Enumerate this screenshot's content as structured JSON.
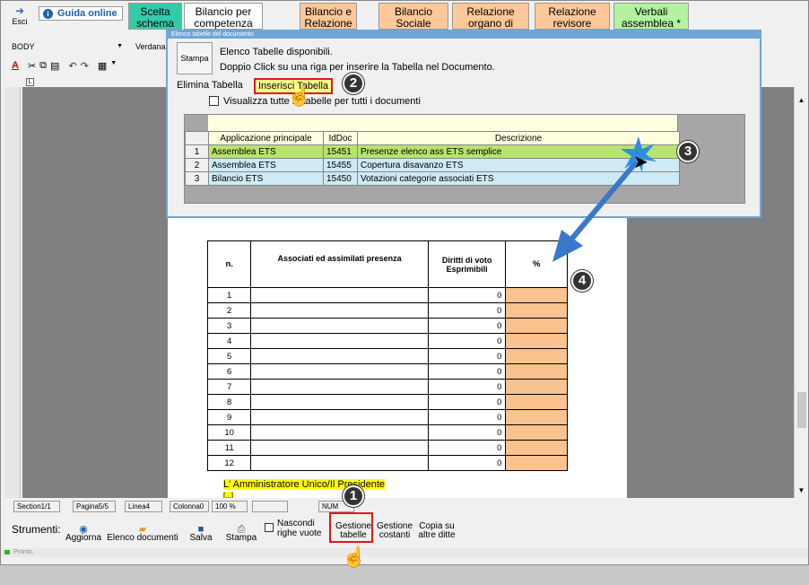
{
  "toolbar": {
    "exit_label": "Esci",
    "guide_label": "Guida online",
    "tabs": [
      {
        "label": "Scelta schema",
        "color": "#33ccaa"
      },
      {
        "label": "Bilancio per competenza",
        "color": "#ffffff"
      },
      {
        "label": "Bilancio e Relazione",
        "color": "#ffc89a"
      },
      {
        "label": "Bilancio Sociale",
        "color": "#ffc89a"
      },
      {
        "label": "Relazione organo di",
        "color": "#ffc89a"
      },
      {
        "label": "Relazione revisore",
        "color": "#ffc89a"
      },
      {
        "label": "Verbali assemblea *",
        "color": "#b2f2a0"
      }
    ],
    "style_select": "BODY",
    "font_select": "Verdana"
  },
  "dialog": {
    "title": "Elenco tabelle del documento",
    "print_label": "Stampa",
    "line1": "Elenco Tabelle disponibili.",
    "line2": "Doppio Click su una riga per inserire la Tabella nel Documento.",
    "delete_label": "Elimina Tabella",
    "insert_label": "Inserisci Tabella",
    "checkbox_label": "Visualizza tutte le tabelle per tutti i documenti",
    "columns": [
      "Applicazione principale",
      "IdDoc",
      "Descrizione"
    ],
    "rows": [
      {
        "n": "1",
        "app": "Assemblea ETS",
        "id": "15451",
        "desc": "Presenze elenco ass ETS semplice"
      },
      {
        "n": "2",
        "app": "Assemblea ETS",
        "id": "15455",
        "desc": "Copertura disavanzo ETS"
      },
      {
        "n": "3",
        "app": "Bilancio ETS",
        "id": "15450",
        "desc": "Votazioni categorie associati ETS"
      }
    ]
  },
  "document": {
    "headers": [
      "n.",
      "Associati ed assimilati presenza",
      "Diritti di voto Esprimibili",
      "%"
    ],
    "rows": [
      {
        "n": "1",
        "v": "0"
      },
      {
        "n": "2",
        "v": "0"
      },
      {
        "n": "3",
        "v": "0"
      },
      {
        "n": "4",
        "v": "0"
      },
      {
        "n": "5",
        "v": "0"
      },
      {
        "n": "6",
        "v": "0"
      },
      {
        "n": "7",
        "v": "0"
      },
      {
        "n": "8",
        "v": "0"
      },
      {
        "n": "9",
        "v": "0"
      },
      {
        "n": "10",
        "v": "0"
      },
      {
        "n": "11",
        "v": "0"
      },
      {
        "n": "12",
        "v": "0"
      }
    ],
    "signature": "L' Amministratore Unico/Il Presidente",
    "signature_tail": "[...]"
  },
  "statusbar": {
    "section": "Section1/1",
    "page": "Pagina5/5",
    "line": "Linea4",
    "column": "Colonna0",
    "zoom": "100 %",
    "num": "NUM",
    "ready": "Pronto."
  },
  "tools": {
    "label": "Strumenti:",
    "refresh": "Aggiorna",
    "doc_list": "Elenco documenti",
    "save": "Salva",
    "print": "Stampa",
    "hide_empty_1": "Nascondi",
    "hide_empty_2": "righe vuote",
    "manage_tables_1": "Gestione",
    "manage_tables_2": "tabelle",
    "manage_consts_1": "Gestione",
    "manage_consts_2": "costanti",
    "copy_1": "Copia su",
    "copy_2": "altre ditte"
  },
  "steps": [
    "1",
    "2",
    "3",
    "4"
  ],
  "colors": {
    "accent": "#6fa6d8",
    "highlight_red": "#e0161c",
    "selected_row": "#b7e36e",
    "row_blue": "#cdeaf5",
    "pct_cell": "#fac28f",
    "signature_yellow": "#ffff00"
  }
}
